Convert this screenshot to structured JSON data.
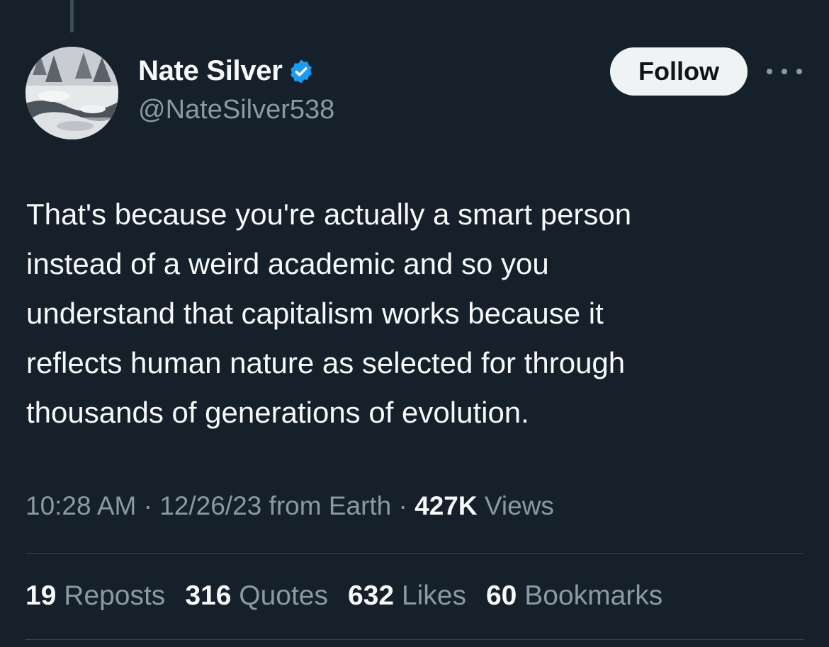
{
  "author": {
    "display_name": "Nate Silver",
    "handle": "@NateSilver538",
    "verified_icon": "verified-badge-icon",
    "verified_color": "#1d9bf0"
  },
  "actions": {
    "follow_label": "Follow",
    "more_icon": "more-options-icon"
  },
  "tweet": {
    "text_lines": [
      "That's because you're actually a smart person",
      "instead of a weird academic and so you",
      "understand that capitalism works because it",
      "reflects human nature as selected for through",
      "thousands of generations of evolution."
    ]
  },
  "meta": {
    "time": "10:28 AM",
    "date": "12/26/23",
    "source": "from Earth",
    "separator": "·",
    "views_count": "427K",
    "views_label": "Views"
  },
  "stats": [
    {
      "count": "19",
      "label": "Reposts"
    },
    {
      "count": "316",
      "label": "Quotes"
    },
    {
      "count": "632",
      "label": "Likes"
    },
    {
      "count": "60",
      "label": "Bookmarks"
    }
  ],
  "colors": {
    "background": "#15202b",
    "primary_text": "#f7f9f9",
    "secondary_text": "#8b98a5",
    "divider": "#38444d",
    "follow_button_bg": "#eff3f4"
  }
}
